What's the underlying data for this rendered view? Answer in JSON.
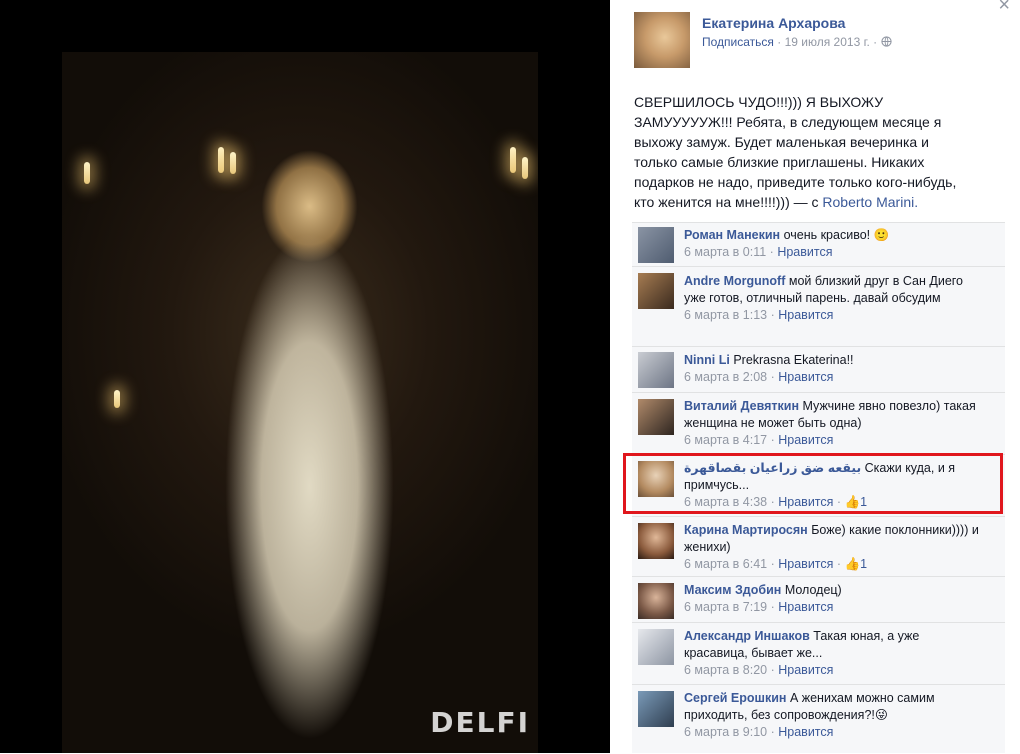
{
  "photo": {
    "watermark": "DELFI"
  },
  "post": {
    "author_name": "Екатерина Архарова",
    "subscribe_label": "Подписаться",
    "separator": "·",
    "date": "19 июля 2013 г.",
    "privacy_icon": "globe-icon",
    "close_icon": "close-icon",
    "text": "СВЕРШИЛОСЬ ЧУДО!!!))) Я ВЫХОЖУ ЗАМУУУУУЖ!!! Ребята, в следующем месяце я выхожу замуж. Будет маленькая вечеринка и только самые близкие приглашены. Никаких подарков не надо, приведите только кого-нибудь, кто женится на мне!!!!))) — с",
    "tagged_name": "Roberto Marini."
  },
  "comments": [
    {
      "name": "Роман Манекин",
      "text": "очень красиво! 🙂",
      "time": "6 марта в 0:11",
      "like": "Нравится",
      "likes": ""
    },
    {
      "name": "Andre Morgunoff",
      "text": "мой близкий друг в Сан Диего уже готов, отличный парень. давай обсудим",
      "time": "6 марта в 1:13",
      "like": "Нравится",
      "likes": ""
    },
    {
      "name": "Ninni Li",
      "text": "Prekrasna Ekaterina!!",
      "time": "6 марта в 2:08",
      "like": "Нравится",
      "likes": ""
    },
    {
      "name": "Виталий Девяткин",
      "text": "Мужчине явно повезло) такая женщина не может быть одна)",
      "time": "6 марта в 4:17",
      "like": "Нравится",
      "likes": ""
    },
    {
      "name": "بيقعه ضق زراعيان بقصاقهرة",
      "text": "Скажи куда, и я примчусь...",
      "time": "6 марта в 4:38",
      "like": "Нравится",
      "likes": "👍1"
    },
    {
      "name": "Карина Мартиросян",
      "text": "Боже) какие поклонники)))) и женихи)",
      "time": "6 марта в 6:41",
      "like": "Нравится",
      "likes": "👍1"
    },
    {
      "name": "Максим Здобин",
      "text": "Молодец)",
      "time": "6 марта в 7:19",
      "like": "Нравится",
      "likes": ""
    },
    {
      "name": "Александр Иншаков",
      "text": "Такая юная, а уже красавица, бывает же...",
      "time": "6 марта в 8:20",
      "like": "Нравится",
      "likes": ""
    },
    {
      "name": "Сергей Ерошкин",
      "text": "А женихам можно самим приходить, без сопровождения?!😜",
      "time": "6 марта в 9:10",
      "like": "Нравится",
      "likes": ""
    }
  ],
  "colors": {
    "link": "#3b5998",
    "meta": "#9197a3",
    "comment_bg": "#f6f7f9",
    "highlight": "#e0161c"
  }
}
